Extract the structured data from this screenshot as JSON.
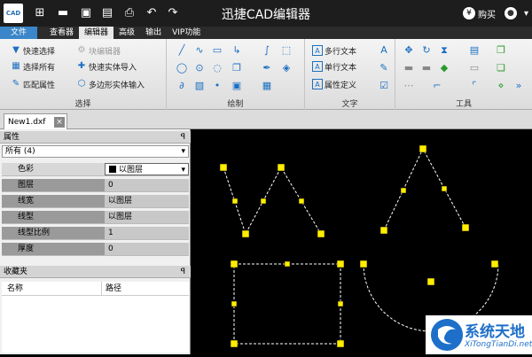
{
  "app": {
    "title": "迅捷CAD编辑器",
    "logo_text": "CAD",
    "buy_label": "购买"
  },
  "menu": [
    {
      "label": "文件"
    },
    {
      "label": "查看器"
    },
    {
      "label": "编辑器"
    },
    {
      "label": "高级"
    },
    {
      "label": "输出"
    },
    {
      "label": "VIP功能"
    }
  ],
  "ribbon": {
    "select": {
      "label": "选择",
      "quick_select": "快速选择",
      "select_all": "选择所有",
      "match_props": "匹配属性",
      "block_editor": "块编辑器",
      "quick_entity_import": "快速实体导入",
      "polygon_entity_input": "多边形实体输入"
    },
    "draw": {
      "label": "绘制"
    },
    "text": {
      "label": "文字",
      "mtext": "多行文本",
      "stext": "单行文本",
      "attdef": "属性定义"
    },
    "tools": {
      "label": "工具"
    }
  },
  "document_tab": {
    "name": "New1.dxf",
    "close": "×"
  },
  "properties": {
    "title": "属性",
    "filter": "所有 (4)",
    "rows": [
      {
        "key": "色彩",
        "value": "以图层"
      },
      {
        "key": "图层",
        "value": "0"
      },
      {
        "key": "线宽",
        "value": "以图层"
      },
      {
        "key": "线型",
        "value": "以图层"
      },
      {
        "key": "线型比例",
        "value": "1"
      },
      {
        "key": "厚度",
        "value": "0"
      }
    ]
  },
  "favorites": {
    "title": "收藏夹",
    "col_name": "名称",
    "col_path": "路径"
  },
  "watermark": {
    "name": "系统天地",
    "url": "XiTongTianDi.net"
  }
}
